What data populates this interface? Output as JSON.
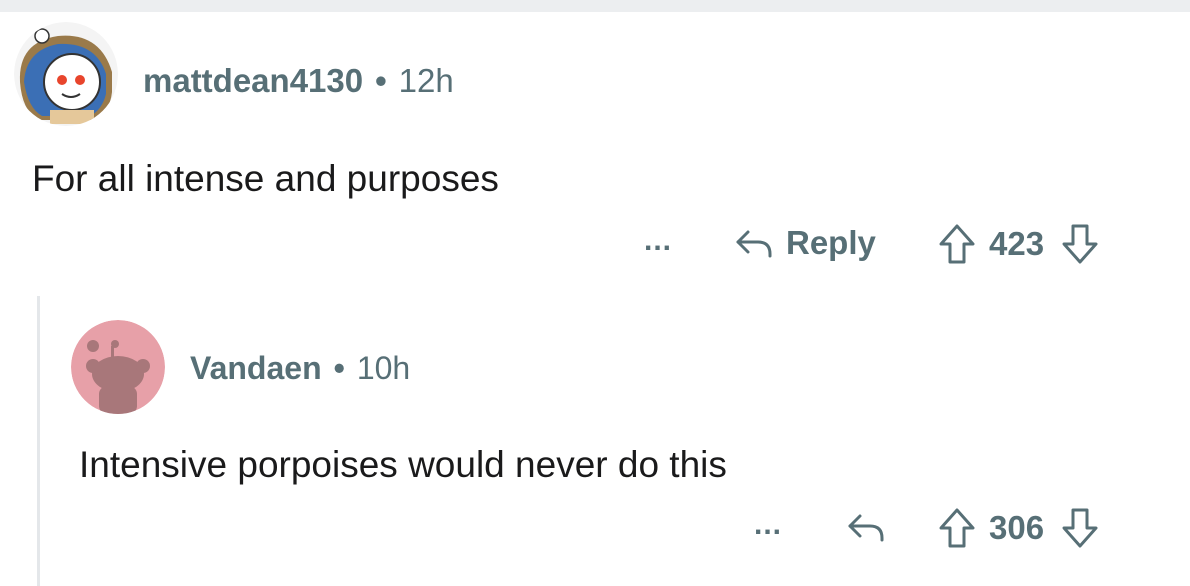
{
  "comments": [
    {
      "username": "mattdean4130",
      "separator": "•",
      "time": "12h",
      "text": "For all intense and purposes",
      "more_label": "...",
      "reply_label": "Reply",
      "votes": "423"
    },
    {
      "username": "Vandaen",
      "separator": "•",
      "time": "10h",
      "text": "Intensive porpoises would never do this",
      "more_label": "...",
      "votes": "306"
    }
  ],
  "colors": {
    "meta_text": "#576f76",
    "body_text": "#1a1a1b",
    "thread_line": "#e4e7ea",
    "avatar2_bg": "#e7a0a8"
  }
}
